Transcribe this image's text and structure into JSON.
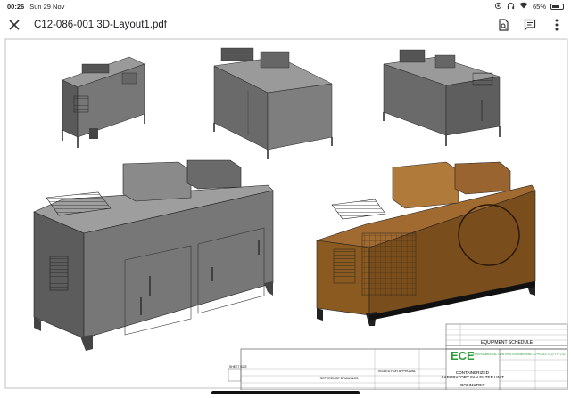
{
  "status_bar": {
    "time": "00:26",
    "date": "Sun 29 Nov",
    "battery": "65%"
  },
  "toolbar": {
    "close_icon": "close-icon",
    "title": "C12-086-001 3D-Layout1.pdf",
    "icons": [
      "search-in-document-icon",
      "comment-icon",
      "more-vert-icon"
    ]
  },
  "drawing": {
    "schedule_title": "EQUIPMENT SCHEDULE",
    "company_logo": "ECE",
    "company_name": "ENVIRONMENTAL CONTROL ENGINEERING & PROJECTS (PTY) LTD",
    "project_title": "CONTAINERIZED LABORATORY FAN FILTER UNIT",
    "client": "POLIMATRIX",
    "issued_for": "ISSUED FOR APPROVAL",
    "reference_drawings": "REFERENCE DRAWINGS",
    "sheet_size": "SHEET SIZE"
  },
  "colors": {
    "unit_fill": "#6e6e6e",
    "unit_dark": "#4a4a4a",
    "unit_light": "#8c8c8c",
    "unit_transparent": "#8a5a20",
    "logo_green": "#2e9b3a"
  }
}
